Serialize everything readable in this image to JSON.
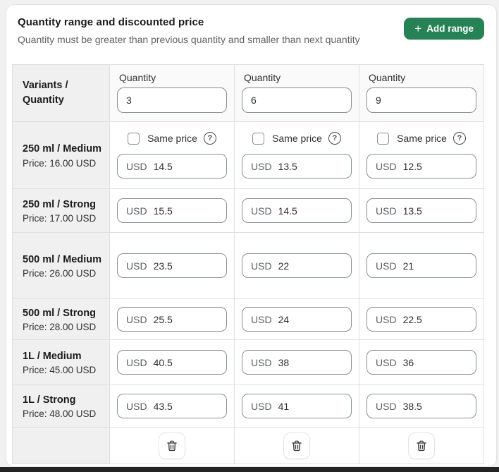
{
  "colors": {
    "accent_green": "#268255"
  },
  "header": {
    "title": "Quantity range and discounted price",
    "subtitle": "Quantity must be greater than previous quantity and smaller than next quantity",
    "add_range": {
      "icon": "+",
      "label": "Add range"
    }
  },
  "table": {
    "corner_header": "Variants / Quantity",
    "quantity_label": "Quantity",
    "quantities": [
      "3",
      "6",
      "9"
    ],
    "same_price_label": "Same price",
    "help_icon": "?",
    "currency_prefix": "USD",
    "rows": [
      {
        "name": "250 ml / Medium",
        "price": "Price: 16.00 USD",
        "values": [
          "14.5",
          "13.5",
          "12.5"
        ]
      },
      {
        "name": "250 ml / Strong",
        "price": "Price: 17.00 USD",
        "values": [
          "15.5",
          "14.5",
          "13.5"
        ]
      },
      {
        "name": "500 ml / Medium",
        "price": "Price: 26.00 USD",
        "values": [
          "23.5",
          "22",
          "21"
        ]
      },
      {
        "name": "500 ml / Strong",
        "price": "Price: 28.00 USD",
        "values": [
          "25.5",
          "24",
          "22.5"
        ]
      },
      {
        "name": "1L / Medium",
        "price": "Price: 45.00 USD",
        "values": [
          "40.5",
          "38",
          "36"
        ]
      },
      {
        "name": "1L / Strong",
        "price": "Price: 48.00 USD",
        "values": [
          "43.5",
          "41",
          "38.5"
        ]
      }
    ]
  }
}
